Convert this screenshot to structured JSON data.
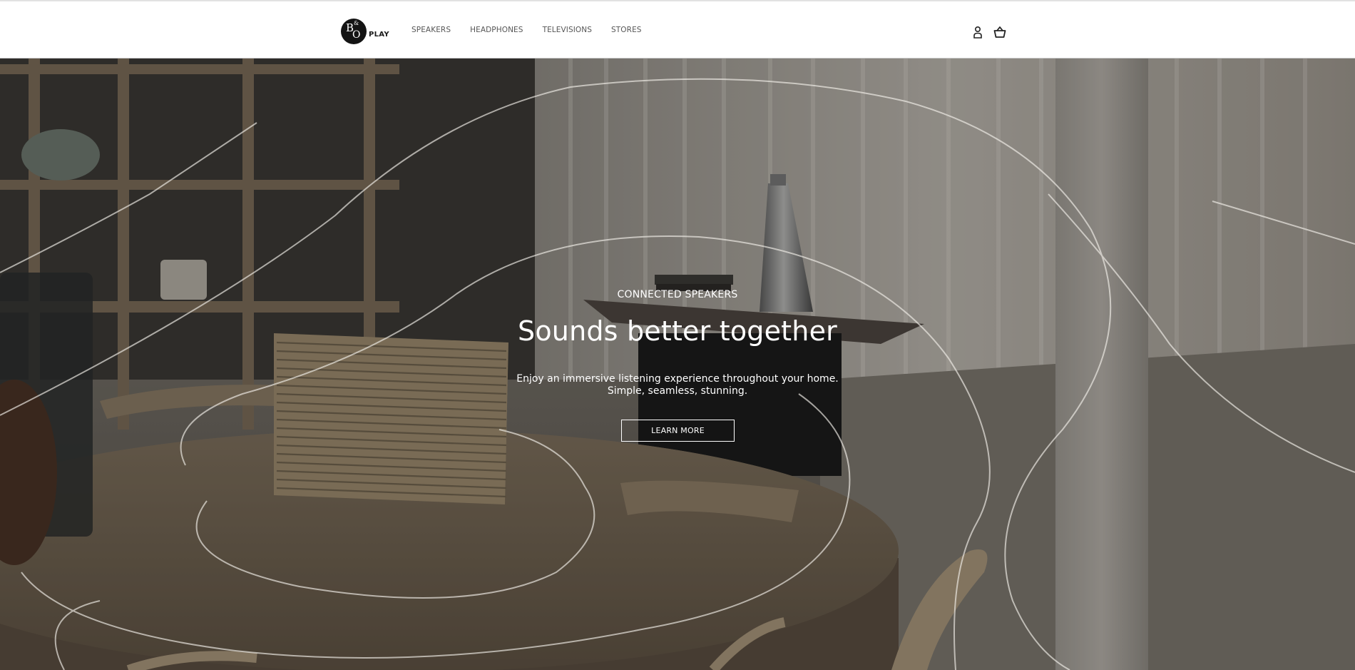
{
  "brand": {
    "logo_mark": "B&O",
    "logo_text": "PLAY"
  },
  "nav": {
    "items": [
      {
        "label": "SPEAKERS"
      },
      {
        "label": "HEADPHONES"
      },
      {
        "label": "TELEVISIONS"
      },
      {
        "label": "STORES"
      }
    ]
  },
  "header_icons": [
    "account-icon",
    "cart-icon"
  ],
  "hero": {
    "eyebrow": "CONNECTED SPEAKERS",
    "title": "Sounds better together",
    "description_line1": "Enjoy an immersive listening experience throughout your home.",
    "description_line2": "Simple, seamless, stunning.",
    "cta_label": "LEARN MORE"
  },
  "colors": {
    "header_bg": "#ffffff",
    "nav_text": "#555555",
    "hero_text": "#ffffff",
    "logo_bg": "#141414"
  }
}
